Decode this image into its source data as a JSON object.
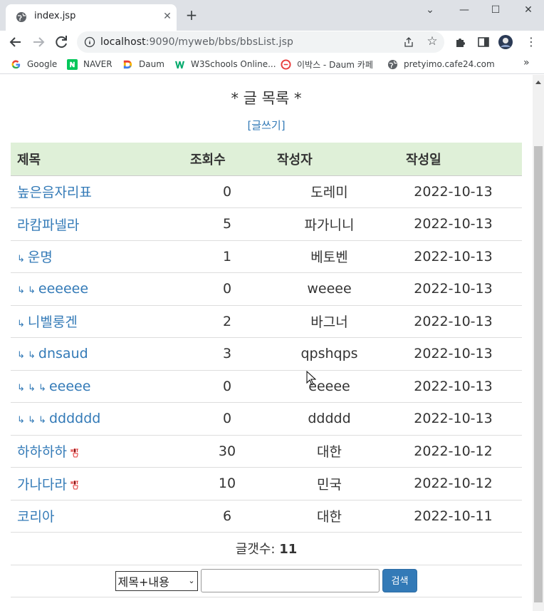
{
  "browser": {
    "tab_title": "index.jsp",
    "url_host": "localhost",
    "url_rest": ":9090/myweb/bbs/bbsList.jsp",
    "bookmarks": [
      {
        "label": "Google",
        "icon": "google-icon"
      },
      {
        "label": "NAVER",
        "icon": "naver-icon"
      },
      {
        "label": "Daum",
        "icon": "daum-icon"
      },
      {
        "label": "W3Schools Online...",
        "icon": "w3schools-icon"
      },
      {
        "label": "이박스 - Daum 카페",
        "icon": "cafe-icon"
      },
      {
        "label": "pretyimo.cafe24.com",
        "icon": "globe-icon"
      }
    ]
  },
  "page": {
    "heading": "* 글 목록 *",
    "write_link": "[글쓰기]",
    "columns": {
      "title": "제목",
      "views": "조회수",
      "writer": "작성자",
      "date": "작성일"
    },
    "rows": [
      {
        "reply": "",
        "title": "높은음자리표",
        "views": "0",
        "writer": "도레미",
        "date": "2022-10-13",
        "hot": false
      },
      {
        "reply": "",
        "title": "라캄파넬라",
        "views": "5",
        "writer": "파가니니",
        "date": "2022-10-13",
        "hot": false
      },
      {
        "reply": "ㅋ",
        "title": "운명",
        "views": "1",
        "writer": "베토벤",
        "date": "2022-10-13",
        "hot": false
      },
      {
        "reply": "ㅋ ㅋ",
        "title": "eeeeee",
        "views": "0",
        "writer": "weeee",
        "date": "2022-10-13",
        "hot": false
      },
      {
        "reply": "ㅋ",
        "title": "니벨룽겐",
        "views": "2",
        "writer": "바그너",
        "date": "2022-10-13",
        "hot": false
      },
      {
        "reply": "ㅋ ㅋ",
        "title": "dnsaud",
        "views": "3",
        "writer": "qpshqps",
        "date": "2022-10-13",
        "hot": false
      },
      {
        "reply": "ㅋ ㅋ ㅋ",
        "title": "eeeee",
        "views": "0",
        "writer": "eeeee",
        "date": "2022-10-13",
        "hot": false
      },
      {
        "reply": "ㅋ ㅋ ㅋ",
        "title": "dddddd",
        "views": "0",
        "writer": "ddddd",
        "date": "2022-10-13",
        "hot": false
      },
      {
        "reply": "",
        "title": "하하하하",
        "views": "30",
        "writer": "대한",
        "date": "2022-10-12",
        "hot": true
      },
      {
        "reply": "",
        "title": "가나다라",
        "views": "10",
        "writer": "민국",
        "date": "2022-10-12",
        "hot": true
      },
      {
        "reply": "",
        "title": "코리아",
        "views": "6",
        "writer": "대한",
        "date": "2022-10-11",
        "hot": false
      }
    ],
    "count_label": "글갯수:",
    "count_value": "11",
    "search": {
      "field_selected": "제목+내용",
      "input_value": "",
      "button_label": "검색"
    }
  },
  "colors": {
    "link": "#337ab7",
    "header_bg": "#dff0d8",
    "button": "#337ab7"
  }
}
